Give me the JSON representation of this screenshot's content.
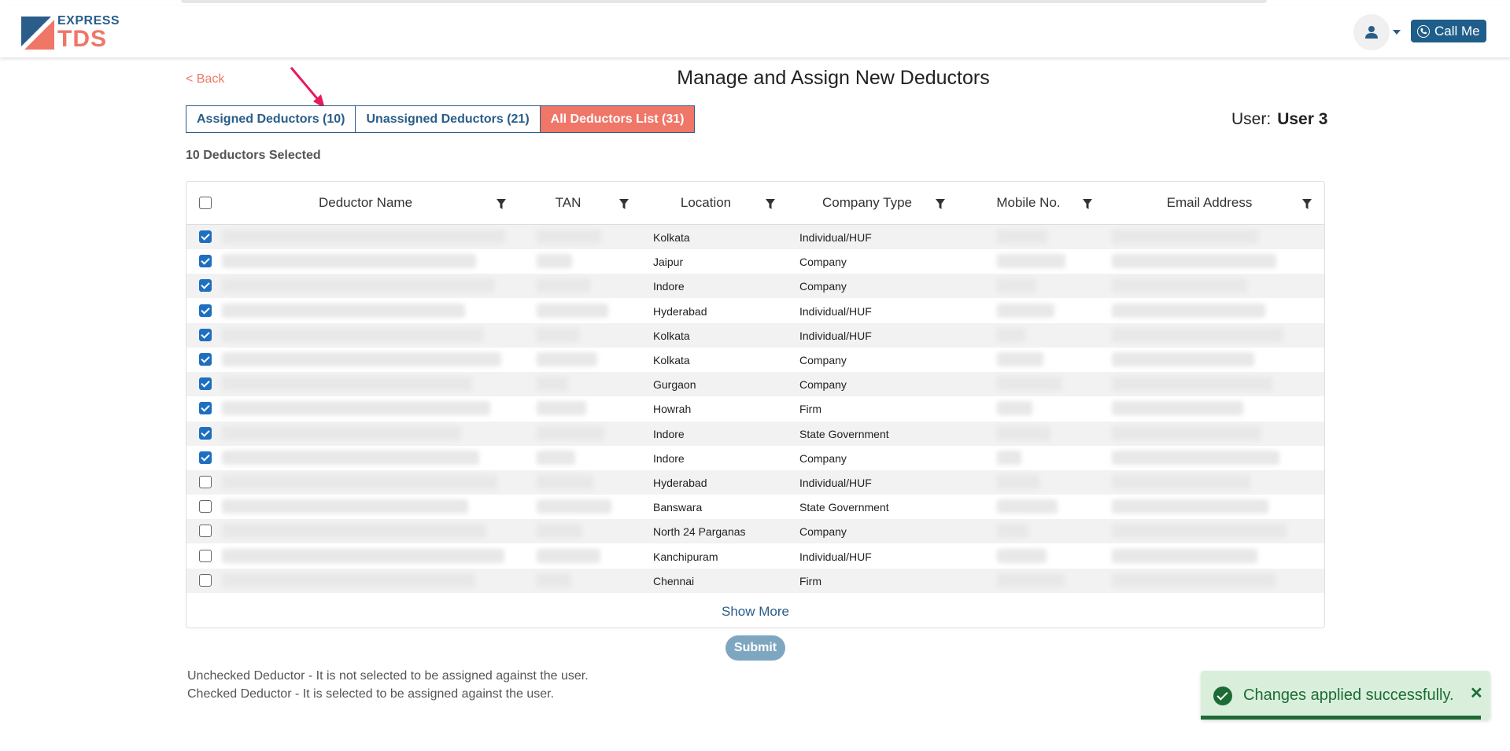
{
  "header": {
    "logo_top": "EXPRESS",
    "logo_bottom": "TDS",
    "call_label": "Call Me"
  },
  "page": {
    "back_label": "< Back",
    "title": "Manage and Assign New Deductors",
    "user_prefix": "User:",
    "user_name": "User 3",
    "selected_text": "10 Deductors Selected"
  },
  "tabs": [
    {
      "label": "Assigned Deductors (10)",
      "active": false
    },
    {
      "label": "Unassigned Deductors (21)",
      "active": false
    },
    {
      "label": "All Deductors List (31)",
      "active": true
    }
  ],
  "table": {
    "columns": [
      "Deductor Name",
      "TAN",
      "Location",
      "Company Type",
      "Mobile No.",
      "Email Address"
    ],
    "rows": [
      {
        "checked": true,
        "location": "Kolkata",
        "company_type": "Individual/HUF"
      },
      {
        "checked": true,
        "location": "Jaipur",
        "company_type": "Company"
      },
      {
        "checked": true,
        "location": "Indore",
        "company_type": "Company"
      },
      {
        "checked": true,
        "location": "Hyderabad",
        "company_type": "Individual/HUF"
      },
      {
        "checked": true,
        "location": "Kolkata",
        "company_type": "Individual/HUF"
      },
      {
        "checked": true,
        "location": "Kolkata",
        "company_type": "Company"
      },
      {
        "checked": true,
        "location": "Gurgaon",
        "company_type": "Company"
      },
      {
        "checked": true,
        "location": "Howrah",
        "company_type": "Firm"
      },
      {
        "checked": true,
        "location": "Indore",
        "company_type": "State Government"
      },
      {
        "checked": true,
        "location": "Indore",
        "company_type": "Company"
      },
      {
        "checked": false,
        "location": "Hyderabad",
        "company_type": "Individual/HUF"
      },
      {
        "checked": false,
        "location": "Banswara",
        "company_type": "State Government"
      },
      {
        "checked": false,
        "location": "North 24 Parganas",
        "company_type": "Company"
      },
      {
        "checked": false,
        "location": "Kanchipuram",
        "company_type": "Individual/HUF"
      },
      {
        "checked": false,
        "location": "Chennai",
        "company_type": "Firm"
      }
    ],
    "show_more": "Show More"
  },
  "submit_label": "Submit",
  "notes": [
    "Unchecked Deductor - It is not selected to be assigned against the user.",
    "Checked Deductor - It is selected to be assigned against the user."
  ],
  "toast": {
    "message": "Changes applied successfully."
  },
  "colors": {
    "brand_blue": "#2a5d8a",
    "accent": "#f07668",
    "success": "#1d6b34",
    "checkbox": "#1e6fbf"
  }
}
